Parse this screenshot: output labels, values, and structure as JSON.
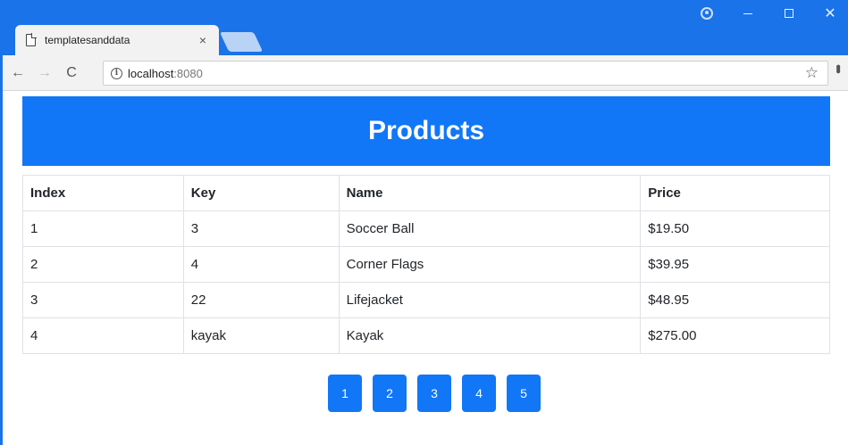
{
  "browser": {
    "tab_title": "templatesanddata",
    "tab_close": "×",
    "url_host": "localhost",
    "url_port": ":8080",
    "win_close": "✕",
    "back": "←",
    "forward": "→",
    "reload": "C",
    "star": "☆",
    "menu": "⋮",
    "info": "i"
  },
  "page": {
    "title": "Products",
    "table": {
      "headers": [
        "Index",
        "Key",
        "Name",
        "Price"
      ],
      "rows": [
        [
          "1",
          "3",
          "Soccer Ball",
          "$19.50"
        ],
        [
          "2",
          "4",
          "Corner Flags",
          "$39.95"
        ],
        [
          "3",
          "22",
          "Lifejacket",
          "$48.95"
        ],
        [
          "4",
          "kayak",
          "Kayak",
          "$275.00"
        ]
      ]
    },
    "pagination": [
      "1",
      "2",
      "3",
      "4",
      "5"
    ]
  },
  "colors": {
    "chrome_blue": "#1a73e8",
    "primary": "#1177f7"
  }
}
